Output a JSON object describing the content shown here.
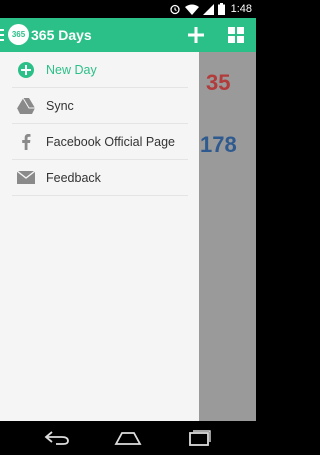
{
  "status_bar": {
    "time": "1:48"
  },
  "app_bar": {
    "logo_text": "365",
    "title": "365 Days"
  },
  "background_counts": {
    "first": "35",
    "second": "178"
  },
  "drawer": {
    "items": [
      {
        "label": "New Day",
        "icon": "add-circle-icon",
        "active": true
      },
      {
        "label": "Sync",
        "icon": "drive-icon"
      },
      {
        "label": "Facebook Official Page",
        "icon": "facebook-icon"
      },
      {
        "label": "Feedback",
        "icon": "mail-icon"
      }
    ]
  },
  "colors": {
    "accent": "#2cc089",
    "red_count": "#b23b3b",
    "blue_count": "#2f5a8f"
  }
}
